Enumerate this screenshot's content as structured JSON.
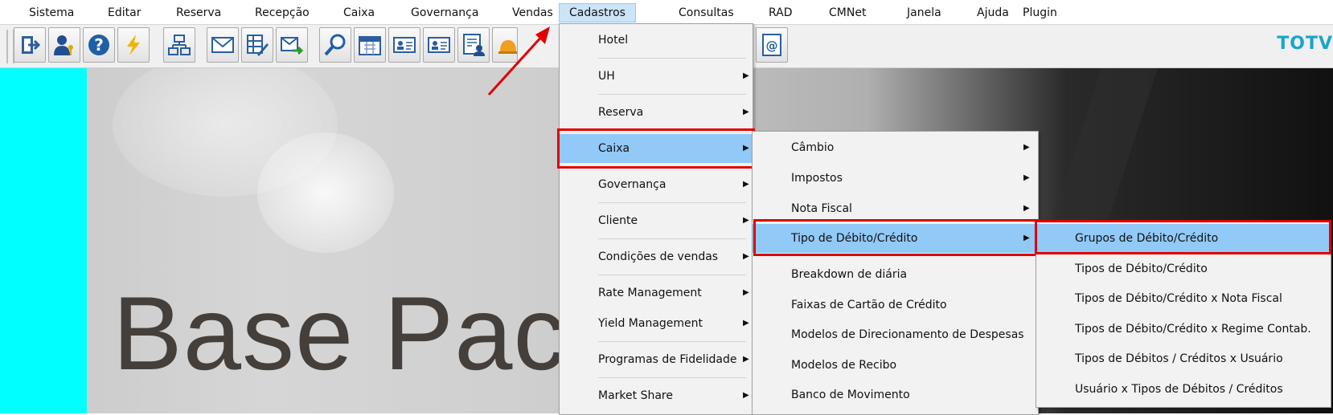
{
  "menubar": {
    "items": [
      "Sistema",
      "Editar",
      "Reserva",
      "Recepção",
      "Caixa",
      "Governança",
      "Vendas",
      "Cadastros",
      "Consultas",
      "RAD",
      "CMNet",
      "Janela",
      "Ajuda",
      "Plugin"
    ]
  },
  "toolbar": {
    "brand": "TOTV",
    "buttons": [
      "logout-icon",
      "user-key-icon",
      "help-icon",
      "lightning-icon",
      "network-icon",
      "mail-icon",
      "grid-edit-icon",
      "send-mail-icon",
      "search-icon",
      "calendar-icon",
      "guest-card-icon",
      "guest-card-icon",
      "report-user-icon",
      "bell-icon",
      "person-icon",
      "address-book-icon"
    ]
  },
  "background": {
    "title": "Base Pac"
  },
  "menus": {
    "cadastros": [
      "Hotel",
      "UH",
      "Reserva",
      "Caixa",
      "Governança",
      "Cliente",
      "Condições de vendas",
      "Rate Management",
      "Yield Management",
      "Programas de Fidelidade",
      "Market Share"
    ],
    "caixa": [
      "Câmbio",
      "Impostos",
      "Nota Fiscal",
      "Tipo de Débito/Crédito",
      "Breakdown de diária",
      "Faixas de Cartão de Crédito",
      "Modelos de Direcionamento de Despesas",
      "Modelos de Recibo",
      "Banco de Movimento"
    ],
    "tipo_debito_credito": [
      "Grupos de Débito/Crédito",
      "Tipos de Débito/Crédito",
      "Tipos de Débito/Crédito x Nota Fiscal",
      "Tipos de Débito/Crédito x Regime Contab.",
      "Tipos de Débitos / Créditos x Usuário",
      "Usuário x Tipos de Débitos / Créditos"
    ]
  },
  "colors": {
    "highlight": "#91c9f7",
    "annotation": "#e00000",
    "brand": "#18a6c8",
    "sidebar": "#00ffff"
  }
}
